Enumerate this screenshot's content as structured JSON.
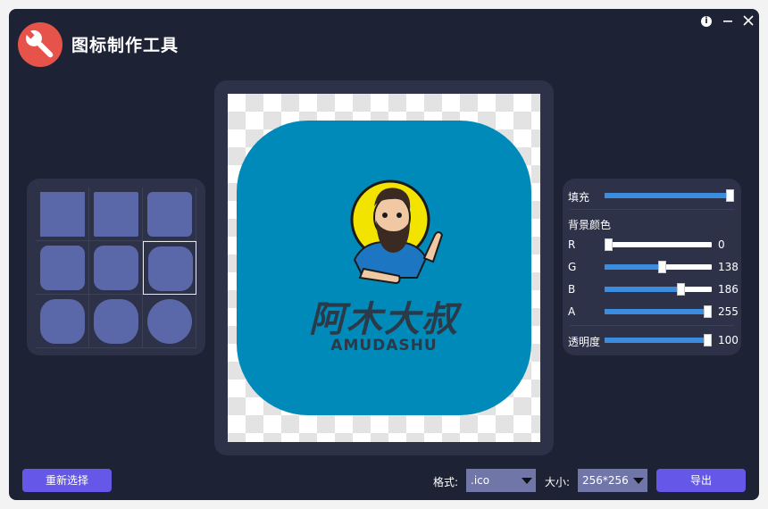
{
  "app": {
    "title": "图标制作工具",
    "info_icon": "info-icon",
    "minimize_icon": "minimize-icon",
    "close_icon": "close-icon"
  },
  "shapes": {
    "selected_index": 5,
    "items": [
      {
        "name": "square",
        "radius": "0"
      },
      {
        "name": "square-slight-round",
        "radius": "2"
      },
      {
        "name": "square-round",
        "radius": "6"
      },
      {
        "name": "round-square-a",
        "radius": "9"
      },
      {
        "name": "round-square-b",
        "radius": "11"
      },
      {
        "name": "round-square-c",
        "radius": "14"
      },
      {
        "name": "squircle-a",
        "radius": "17"
      },
      {
        "name": "squircle-b",
        "radius": "20"
      },
      {
        "name": "circle",
        "radius": "25"
      }
    ]
  },
  "preview": {
    "brand_cn": "阿木大叔",
    "brand_en": "AMUDASHU",
    "background_color": "#008ab9"
  },
  "controls": {
    "fill": {
      "label": "填充",
      "value": 100
    },
    "bg_color_label": "背景颜色",
    "r": {
      "label": "R",
      "value": "0",
      "fraction": 0.0
    },
    "g": {
      "label": "G",
      "value": "138",
      "fraction": 0.541
    },
    "b": {
      "label": "B",
      "value": "186",
      "fraction": 0.729
    },
    "a": {
      "label": "A",
      "value": "255",
      "fraction": 1.0
    },
    "opacity": {
      "label": "透明度",
      "value": "100",
      "fraction": 1.0
    }
  },
  "bottom": {
    "reselect_label": "重新选择",
    "format_label": "格式:",
    "format_value": ".ico",
    "size_label": "大小:",
    "size_value": "256*256",
    "export_label": "导出"
  },
  "colors": {
    "accent": "#6558e8",
    "slider_fill": "#3b8de0",
    "shape_swatch": "#5a67a8",
    "window_bg": "#1e2235",
    "panel_bg": "#2d3249"
  }
}
